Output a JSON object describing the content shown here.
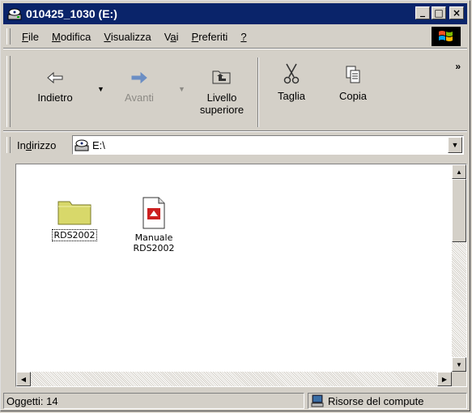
{
  "window": {
    "title": "010425_1030 (E:)",
    "minimize_glyph": "_",
    "maximize_glyph": "□",
    "close_glyph": "×"
  },
  "menu": [
    {
      "label_underline": "F",
      "label_rest": "ile"
    },
    {
      "label_underline": "M",
      "label_rest": "odifica"
    },
    {
      "label_underline": "V",
      "label_rest": "isualizza"
    },
    {
      "label_pre": "V",
      "label_underline": "a",
      "label_rest": "i"
    },
    {
      "label_underline": "P",
      "label_rest": "referiti"
    },
    {
      "label_underline": "?",
      "label_rest": ""
    }
  ],
  "toolbar": {
    "back_label": "Indietro",
    "forward_label": "Avanti",
    "up_label_line1": "Livello",
    "up_label_line2": "superiore",
    "cut_label": "Taglia",
    "copy_label": "Copia",
    "more_glyph": "»"
  },
  "address": {
    "label_pre": "In",
    "label_underline": "d",
    "label_rest": "irizzo",
    "value": "E:\\"
  },
  "files": [
    {
      "name": "RDS2002",
      "icon": "folder-icon",
      "selected": true
    },
    {
      "name_line1": "Manuale",
      "name_line2": "RDS2002",
      "icon": "pdf-document-icon",
      "selected": false
    }
  ],
  "status": {
    "objects": "Oggetti: 14",
    "zone": "Risorse del compute"
  },
  "colors": {
    "titlebar": "#0a246a",
    "chrome": "#d4d0c8",
    "folder": "#d8d86a",
    "pdf_red": "#cc1f1f"
  }
}
